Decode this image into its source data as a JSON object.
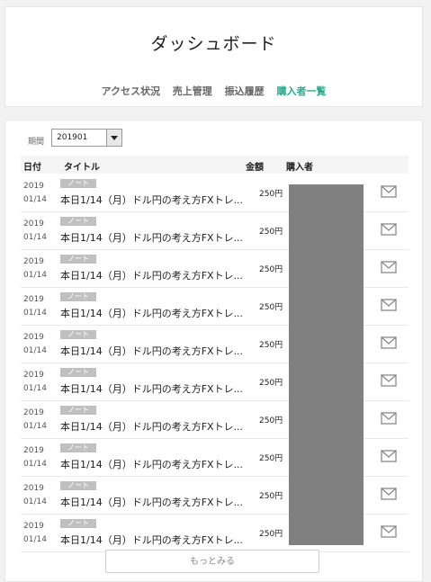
{
  "header": {
    "title": "ダッシュボード",
    "nav": [
      {
        "label": "アクセス状況",
        "active": false
      },
      {
        "label": "売上管理",
        "active": false
      },
      {
        "label": "振込履歴",
        "active": false
      },
      {
        "label": "購入者一覧",
        "active": true
      }
    ],
    "active_color": "#2aa98b"
  },
  "filter": {
    "period_label": "期間",
    "period_value": "201901"
  },
  "table": {
    "columns": {
      "date": "日付",
      "title": "タイトル",
      "amount": "金額",
      "buyer": "購入者"
    },
    "rows": [
      {
        "year": "2019",
        "day": "01/14",
        "badge": "ノート",
        "title": "本日1/14（月）ドル円の考え方FXトレ...",
        "amount": "250円",
        "mail_icon": "envelope-icon"
      },
      {
        "year": "2019",
        "day": "01/14",
        "badge": "ノート",
        "title": "本日1/14（月）ドル円の考え方FXトレ...",
        "amount": "250円",
        "mail_icon": "envelope-icon"
      },
      {
        "year": "2019",
        "day": "01/14",
        "badge": "ノート",
        "title": "本日1/14（月）ドル円の考え方FXトレ...",
        "amount": "250円",
        "mail_icon": "envelope-icon"
      },
      {
        "year": "2019",
        "day": "01/14",
        "badge": "ノート",
        "title": "本日1/14（月）ドル円の考え方FXトレ...",
        "amount": "250円",
        "mail_icon": "envelope-icon"
      },
      {
        "year": "2019",
        "day": "01/14",
        "badge": "ノート",
        "title": "本日1/14（月）ドル円の考え方FXトレ...",
        "amount": "250円",
        "mail_icon": "envelope-icon"
      },
      {
        "year": "2019",
        "day": "01/14",
        "badge": "ノート",
        "title": "本日1/14（月）ドル円の考え方FXトレ...",
        "amount": "250円",
        "mail_icon": "envelope-icon"
      },
      {
        "year": "2019",
        "day": "01/14",
        "badge": "ノート",
        "title": "本日1/14（月）ドル円の考え方FXトレ...",
        "amount": "250円",
        "mail_icon": "envelope-icon"
      },
      {
        "year": "2019",
        "day": "01/14",
        "badge": "ノート",
        "title": "本日1/14（月）ドル円の考え方FXトレ...",
        "amount": "250円",
        "mail_icon": "envelope-icon"
      },
      {
        "year": "2019",
        "day": "01/14",
        "badge": "ノート",
        "title": "本日1/14（月）ドル円の考え方FXトレ...",
        "amount": "250円",
        "mail_icon": "envelope-icon"
      },
      {
        "year": "2019",
        "day": "01/14",
        "badge": "ノート",
        "title": "本日1/14（月）ドル円の考え方FXトレ...",
        "amount": "250円",
        "mail_icon": "envelope-icon"
      }
    ]
  },
  "more_button": "もっとみる"
}
